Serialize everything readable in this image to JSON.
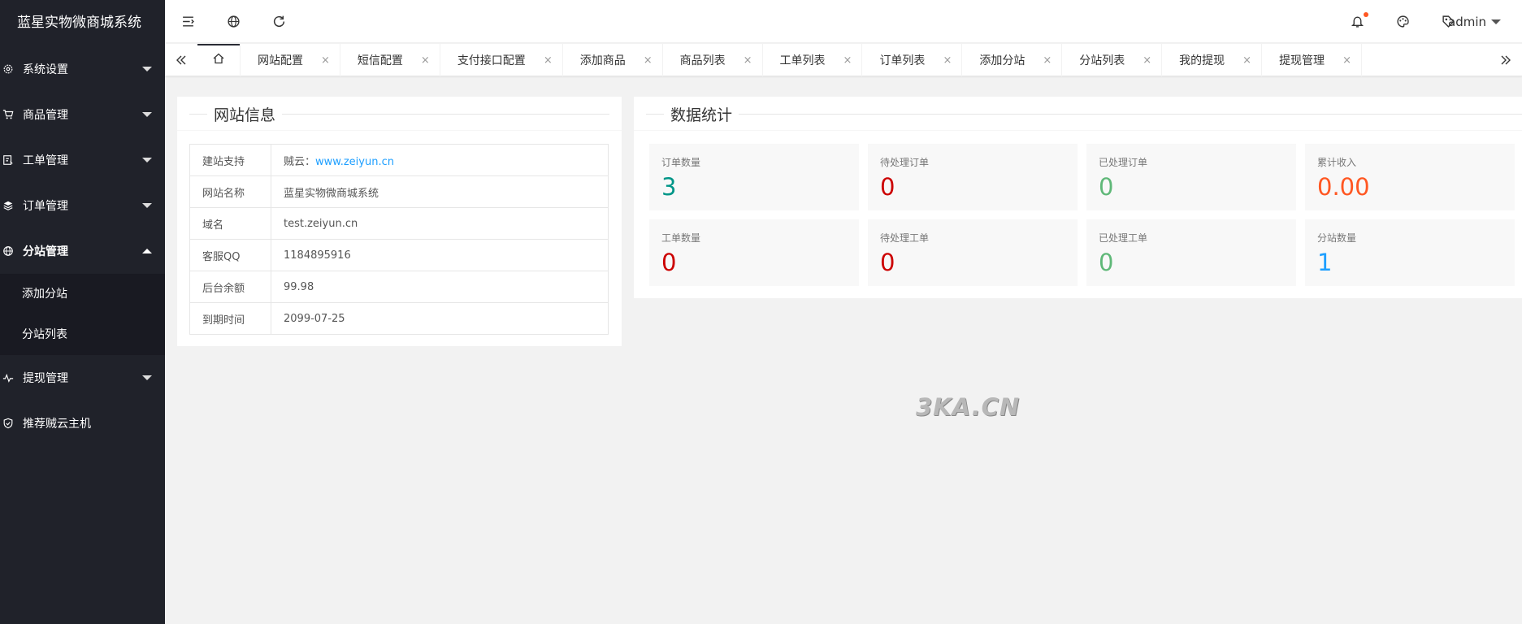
{
  "app": {
    "title": "蓝星实物微商城系统"
  },
  "sidebar": {
    "items": [
      {
        "label": "系统设置",
        "icon": "gear-icon"
      },
      {
        "label": "商品管理",
        "icon": "cart-icon"
      },
      {
        "label": "工单管理",
        "icon": "ticket-icon"
      },
      {
        "label": "订单管理",
        "icon": "layers-icon"
      },
      {
        "label": "分站管理",
        "icon": "globe-icon",
        "subitems": [
          "添加分站",
          "分站列表"
        ]
      },
      {
        "label": "提现管理",
        "icon": "pulse-icon"
      },
      {
        "label": "推荐贼云主机",
        "icon": "shield-icon"
      }
    ]
  },
  "header": {
    "user": "admin"
  },
  "tabs": [
    {
      "label": "网站配置"
    },
    {
      "label": "短信配置"
    },
    {
      "label": "支付接口配置"
    },
    {
      "label": "添加商品"
    },
    {
      "label": "商品列表"
    },
    {
      "label": "工单列表"
    },
    {
      "label": "订单列表"
    },
    {
      "label": "添加分站"
    },
    {
      "label": "分站列表"
    },
    {
      "label": "我的提现"
    },
    {
      "label": "提现管理"
    }
  ],
  "tab_close_glyph": "×",
  "site_info": {
    "title": "网站信息",
    "rows": [
      {
        "key": "建站支持",
        "prefix": "贼云：",
        "link": "www.zeiyun.cn"
      },
      {
        "key": "网站名称",
        "value": "蓝星实物微商城系统"
      },
      {
        "key": "域名",
        "value": "test.zeiyun.cn"
      },
      {
        "key": "客服QQ",
        "value": "1184895916"
      },
      {
        "key": "后台余额",
        "value": "99.98"
      },
      {
        "key": "到期时间",
        "value": "2099-07-25"
      }
    ]
  },
  "stats": {
    "title": "数据统计",
    "items": [
      {
        "label": "订单数量",
        "value": "3",
        "color": "#009688"
      },
      {
        "label": "待处理订单",
        "value": "0",
        "color": "#cc0000"
      },
      {
        "label": "已处理订单",
        "value": "0",
        "color": "#5FB878"
      },
      {
        "label": "累计收入",
        "value": "0.00",
        "color": "#FF5722"
      },
      {
        "label": "工单数量",
        "value": "0",
        "color": "#cc0000"
      },
      {
        "label": "待处理工单",
        "value": "0",
        "color": "#cc0000"
      },
      {
        "label": "已处理工单",
        "value": "0",
        "color": "#5FB878"
      },
      {
        "label": "分站数量",
        "value": "1",
        "color": "#1E9FFF"
      }
    ]
  },
  "watermark": "3KA.CN"
}
